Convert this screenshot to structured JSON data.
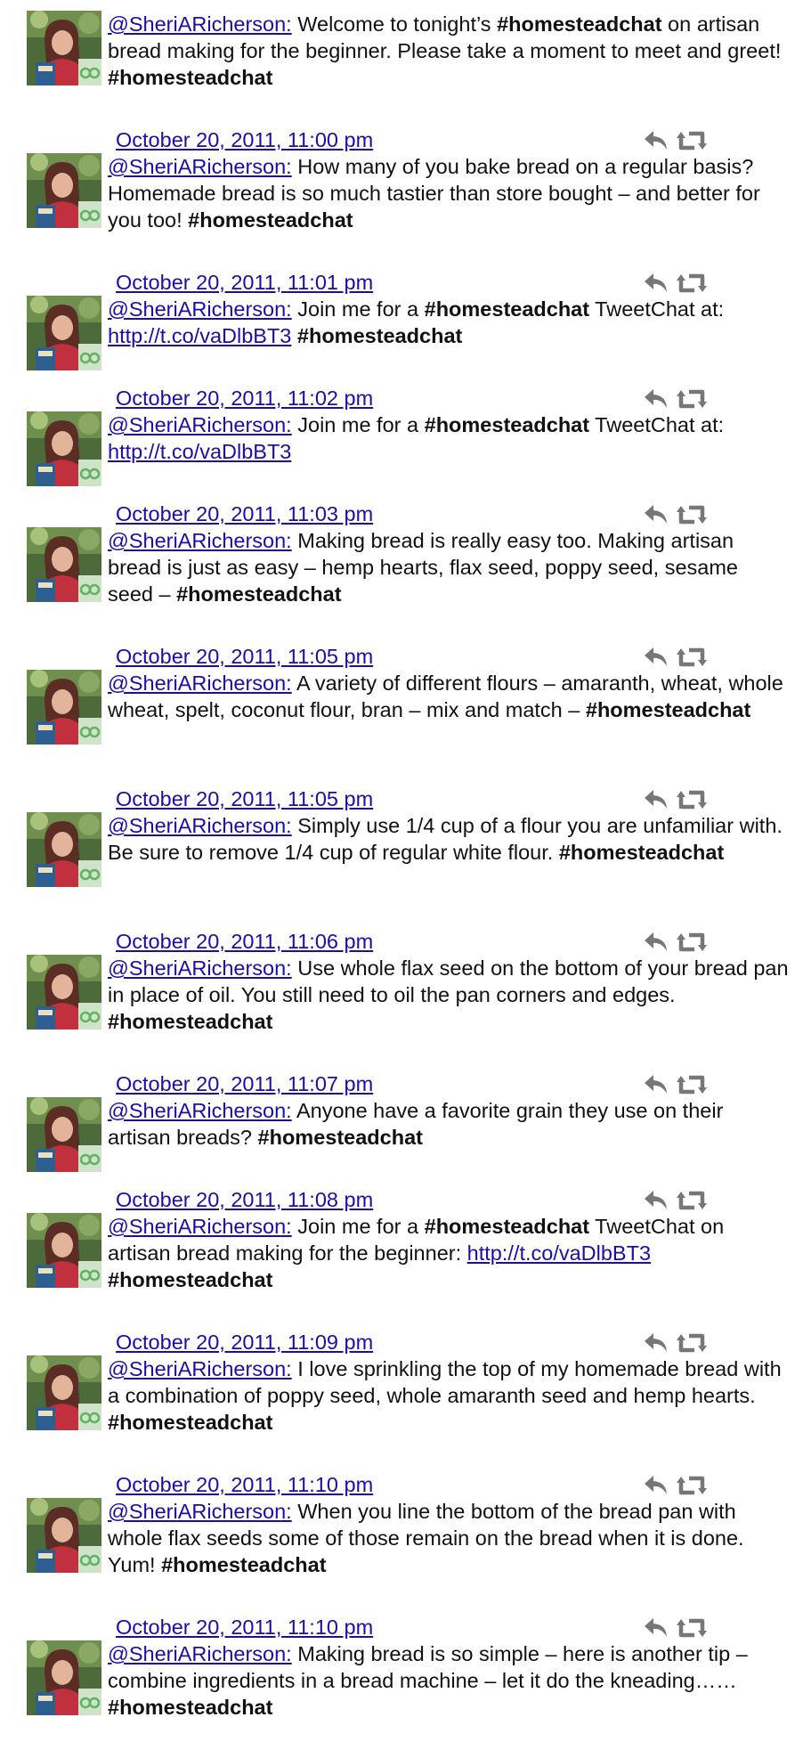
{
  "tweets": [
    {
      "handle": "@SheriARicherson:",
      "parts": [
        {
          "t": " Welcome to tonight’s "
        },
        {
          "t": "#homesteadchat",
          "b": true
        },
        {
          "t": " on artisan bread making for the beginner. Please take a moment to meet and greet! "
        },
        {
          "t": "#homesteadchat",
          "b": true
        }
      ],
      "timestamp": "October 20, 2011, 11:00 pm"
    },
    {
      "handle": "@SheriARicherson:",
      "parts": [
        {
          "t": " How many of you bake bread on a regular basis? Homemade bread is so much tastier than store bought – and better for you too! "
        },
        {
          "t": "#homesteadchat",
          "b": true
        }
      ],
      "timestamp": "October 20, 2011, 11:01 pm"
    },
    {
      "handle": "@SheriARicherson:",
      "parts": [
        {
          "t": " Join me for a "
        },
        {
          "t": "#homesteadchat",
          "b": true
        },
        {
          "t": " TweetChat at: "
        },
        {
          "t": "http://t.co/vaDlbBT3",
          "link": true
        },
        {
          "t": " "
        },
        {
          "t": "#homesteadchat",
          "b": true
        }
      ],
      "timestamp": "October 20, 2011, 11:02 pm"
    },
    {
      "handle": "@SheriARicherson:",
      "parts": [
        {
          "t": " Join me for a "
        },
        {
          "t": "#homesteadchat",
          "b": true
        },
        {
          "t": " TweetChat at: "
        },
        {
          "t": "http://t.co/vaDlbBT3",
          "link": true
        }
      ],
      "timestamp": "October 20, 2011, 11:03 pm"
    },
    {
      "handle": "@SheriARicherson:",
      "parts": [
        {
          "t": " Making bread is really easy too. Making artisan bread is just as easy – hemp hearts, flax seed, poppy seed, sesame seed – "
        },
        {
          "t": "#homesteadchat",
          "b": true
        }
      ],
      "timestamp": "October 20, 2011, 11:05 pm"
    },
    {
      "handle": "@SheriARicherson:",
      "parts": [
        {
          "t": " A variety of different flours – amaranth, wheat, whole wheat, spelt, coconut flour, bran – mix and match – "
        },
        {
          "t": "#homesteadchat",
          "b": true
        }
      ],
      "timestamp": "October 20, 2011, 11:05 pm"
    },
    {
      "handle": "@SheriARicherson:",
      "parts": [
        {
          "t": " Simply use 1/4 cup of a flour you are unfamiliar with. Be sure to remove 1/4 cup of regular white flour. "
        },
        {
          "t": "#homesteadchat",
          "b": true
        }
      ],
      "timestamp": "October 20, 2011, 11:06 pm"
    },
    {
      "handle": "@SheriARicherson:",
      "parts": [
        {
          "t": " Use whole flax seed on the bottom of your bread pan in place of oil. You still need to oil the pan corners and edges. "
        },
        {
          "t": "#homesteadchat",
          "b": true
        }
      ],
      "timestamp": "October 20, 2011, 11:07 pm"
    },
    {
      "handle": "@SheriARicherson:",
      "parts": [
        {
          "t": " Anyone have a favorite grain they use on their artisan breads? "
        },
        {
          "t": "#homesteadchat",
          "b": true
        }
      ],
      "timestamp": "October 20, 2011, 11:08 pm"
    },
    {
      "handle": "@SheriARicherson:",
      "parts": [
        {
          "t": " Join me for a "
        },
        {
          "t": "#homesteadchat",
          "b": true
        },
        {
          "t": " TweetChat on artisan bread making for the beginner: "
        },
        {
          "t": "http://t.co/vaDlbBT3",
          "link": true
        },
        {
          "t": " "
        },
        {
          "t": "#homesteadchat",
          "b": true
        }
      ],
      "timestamp": "October 20, 2011, 11:09 pm"
    },
    {
      "handle": "@SheriARicherson:",
      "parts": [
        {
          "t": " I love sprinkling the top of my homemade bread with a combination of poppy seed, whole amaranth seed and hemp hearts. "
        },
        {
          "t": "#homesteadchat",
          "b": true
        }
      ],
      "timestamp": "October 20, 2011, 11:10 pm"
    },
    {
      "handle": "@SheriARicherson:",
      "parts": [
        {
          "t": " When you line the bottom of the bread pan with whole flax seeds some of those remain on the bread when it is done. Yum! "
        },
        {
          "t": "#homesteadchat",
          "b": true
        }
      ],
      "timestamp": "October 20, 2011, 11:10 pm"
    },
    {
      "handle": "@SheriARicherson:",
      "parts": [
        {
          "t": " Making bread is so simple – here is another tip – combine ingredients in a bread machine – let it do the kneading…… "
        },
        {
          "t": "#homesteadchat",
          "b": true
        }
      ]
    }
  ],
  "icons": {
    "reply": "reply-icon",
    "retweet": "retweet-icon",
    "avatar": "avatar"
  },
  "colors": {
    "link": "#1a0dab",
    "text": "#111111",
    "icon": "#777777"
  }
}
